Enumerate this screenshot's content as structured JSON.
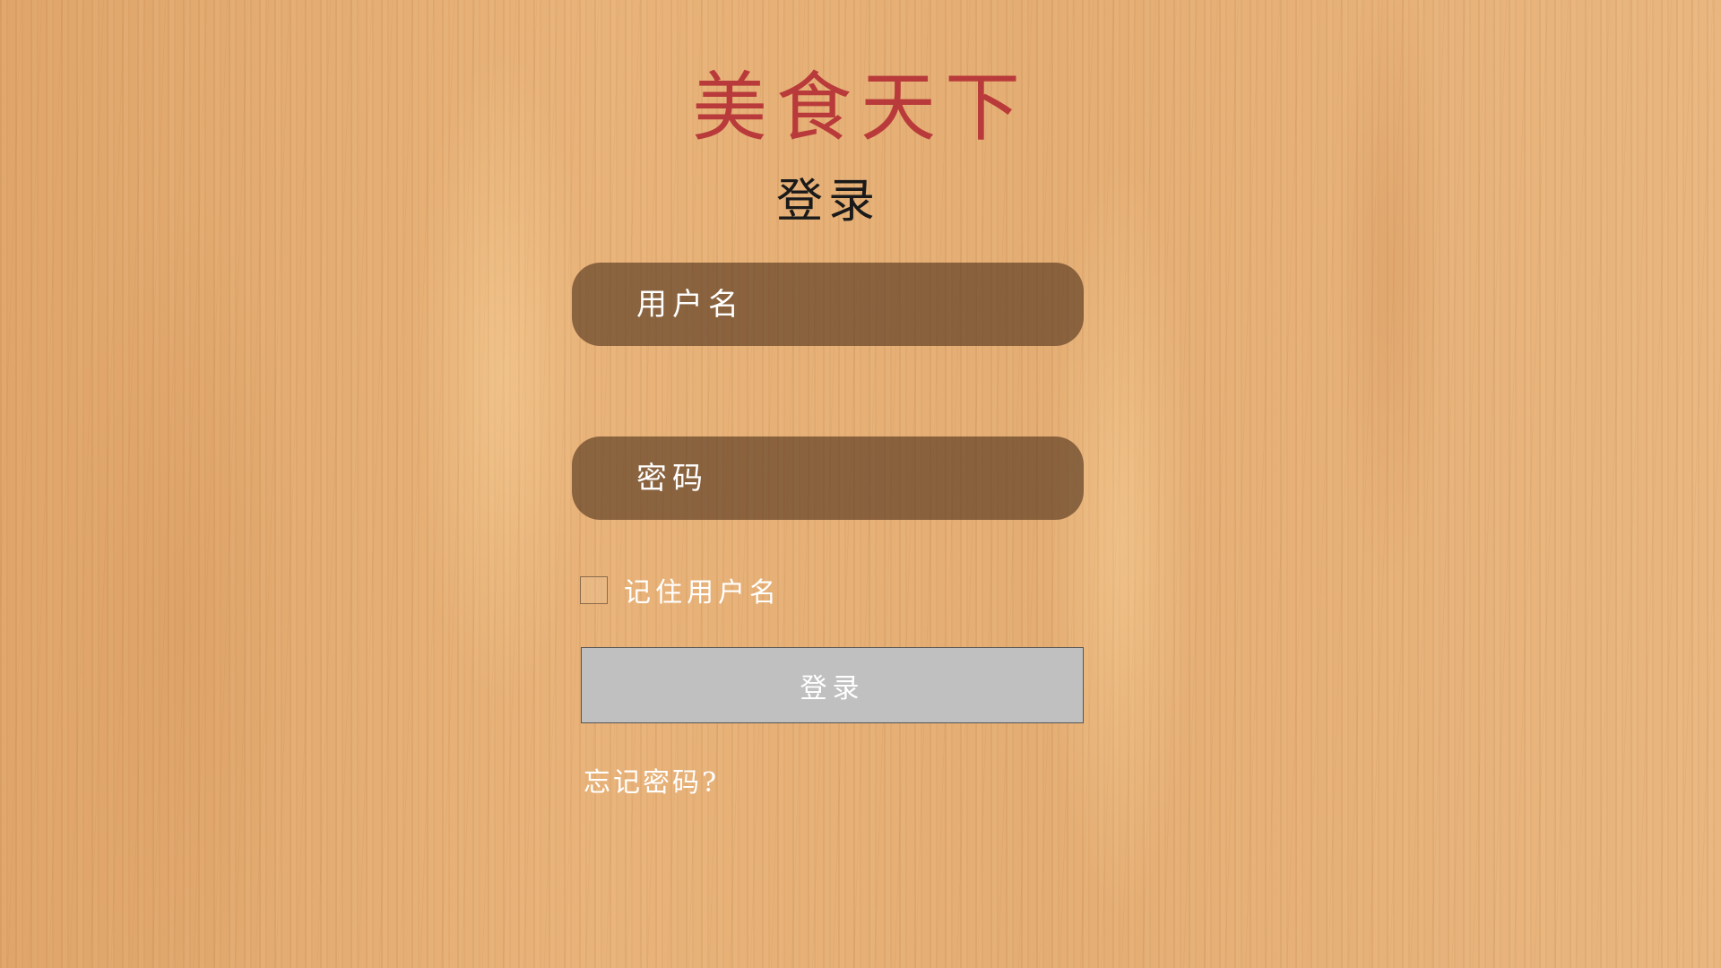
{
  "app": {
    "brand_title": "美食天下"
  },
  "login_form": {
    "heading": "登录",
    "username_placeholder": "用户名",
    "username_value": "",
    "password_placeholder": "密码",
    "password_value": "",
    "remember_label": "记住用户名",
    "remember_checked": false,
    "submit_label": "登录",
    "forgot_password_label": "忘记密码?"
  },
  "colors": {
    "brand_title": "#b93a3a",
    "input_background": "#50321c",
    "button_background": "#c0c0c0",
    "wood_background": "#e4ad72"
  }
}
